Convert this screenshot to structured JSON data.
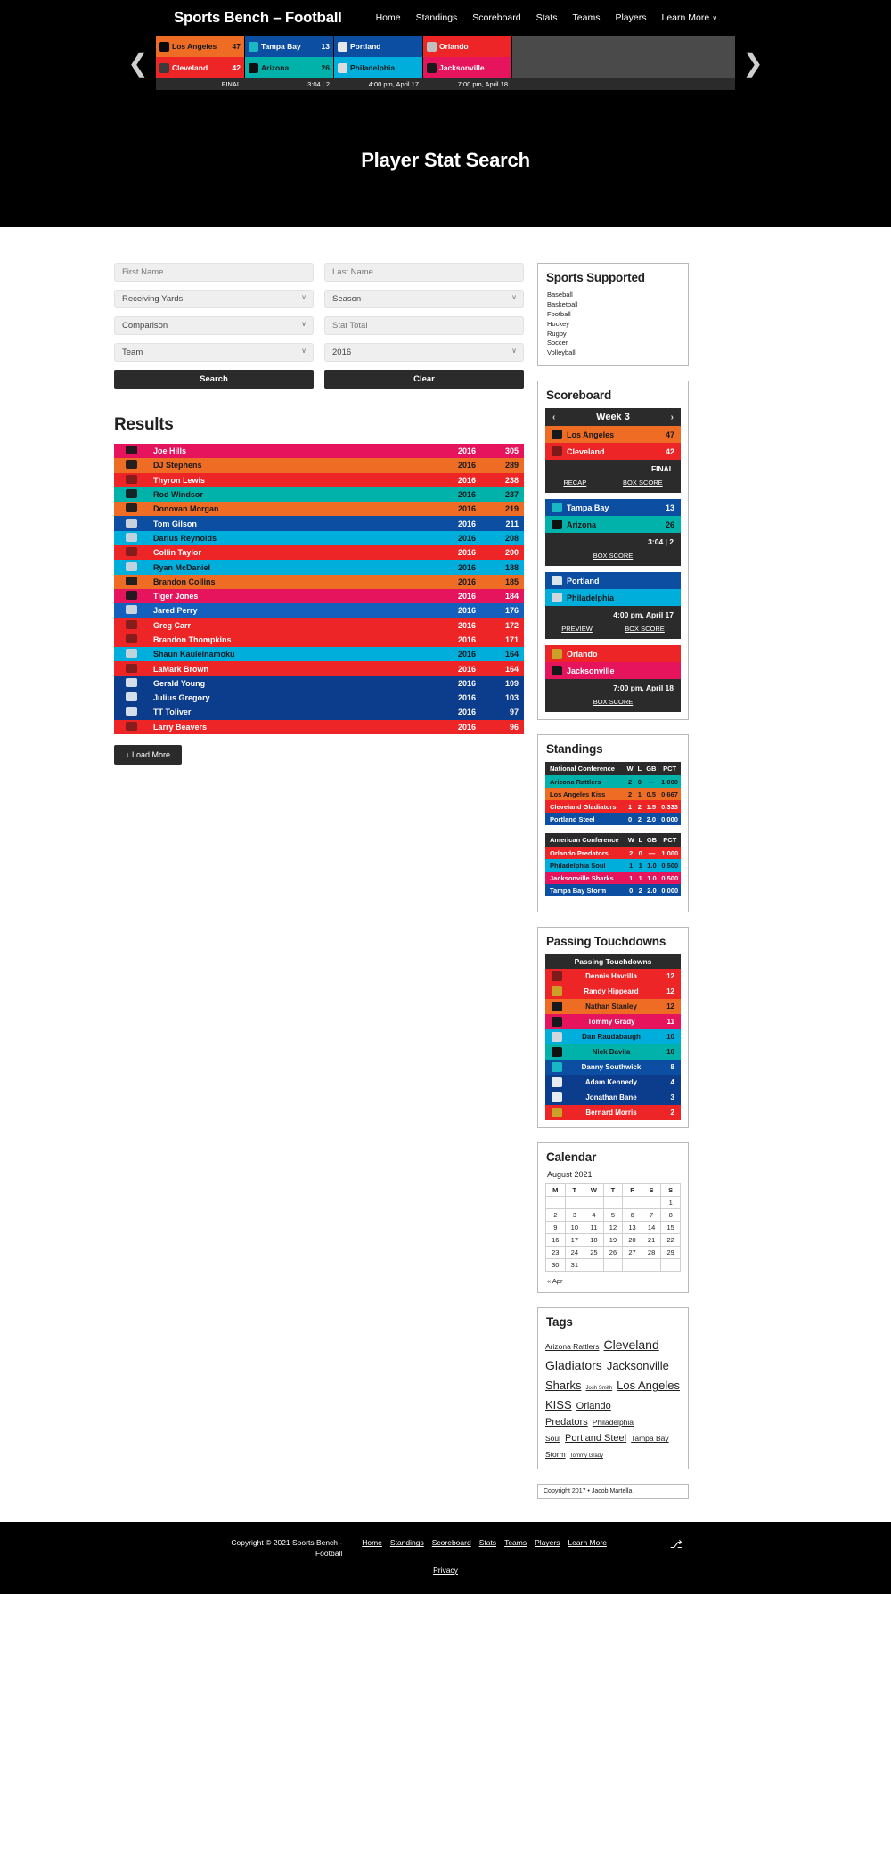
{
  "header": {
    "site_title": "Sports Bench – Football",
    "nav": [
      {
        "label": "Home"
      },
      {
        "label": "Standings"
      },
      {
        "label": "Scoreboard"
      },
      {
        "label": "Stats"
      },
      {
        "label": "Teams"
      },
      {
        "label": "Players"
      },
      {
        "label": "Learn More",
        "caret": "∨"
      }
    ],
    "prev_arrow": "❮",
    "next_arrow": "❯"
  },
  "strip_games": [
    {
      "away": {
        "name": "Los Angeles",
        "score": "47",
        "color": "#ef6c25",
        "logo": "#0a0a0a"
      },
      "home": {
        "name": "Cleveland",
        "score": "42",
        "color": "#ee2527",
        "logo": "#3b3b3b"
      },
      "status": "FINAL"
    },
    {
      "away": {
        "name": "Tampa Bay",
        "score": "13",
        "color": "#0b4ea2",
        "logo": "#19b7c4"
      },
      "home": {
        "name": "Arizona",
        "score": "26",
        "color": "#00b2a9",
        "logo": "#101010"
      },
      "status": "3:04 | 2"
    },
    {
      "away": {
        "name": "Portland",
        "score": "",
        "color": "#0b4ea2",
        "logo": "#e8e8e8"
      },
      "home": {
        "name": "Philadelphia",
        "score": "",
        "color": "#00aedb",
        "logo": "#dddddd"
      },
      "status": "4:00 pm, April 17"
    },
    {
      "away": {
        "name": "Orlando",
        "score": "",
        "color": "#ee2527",
        "logo": "#bfbfbf"
      },
      "home": {
        "name": "Jacksonville",
        "score": "",
        "color": "#e5145c",
        "logo": "#1a1a1a"
      },
      "status": "7:00 pm, April 18"
    }
  ],
  "hero": {
    "title": "Player Stat Search"
  },
  "search_form": {
    "first_name_placeholder": "First Name",
    "last_name_placeholder": "Last Name",
    "stat_selected": "Receiving Yards",
    "season_selected": "Season",
    "comparison_selected": "Comparison",
    "stat_total_placeholder": "Stat Total",
    "team_selected": "Team",
    "year_selected": "2016",
    "search_label": "Search",
    "clear_label": "Clear"
  },
  "results": {
    "heading": "Results",
    "load_more_label": "↓ Load More",
    "rows": [
      {
        "name": "Joe Hills",
        "year": "2016",
        "value": "305",
        "bg": "#e5145c",
        "fg": "#ffffff",
        "logo": "#16191c"
      },
      {
        "name": "DJ Stephens",
        "year": "2016",
        "value": "289",
        "bg": "#ef6c25",
        "fg": "#16191c",
        "logo": "#16191c"
      },
      {
        "name": "Thyron Lewis",
        "year": "2016",
        "value": "238",
        "bg": "#ee2527",
        "fg": "#ffffff",
        "logo": "#7d1b1b"
      },
      {
        "name": "Rod Windsor",
        "year": "2016",
        "value": "237",
        "bg": "#00b2a9",
        "fg": "#16191c",
        "logo": "#16191c"
      },
      {
        "name": "Donovan Morgan",
        "year": "2016",
        "value": "219",
        "bg": "#ef6c25",
        "fg": "#16191c",
        "logo": "#16191c"
      },
      {
        "name": "Tom Gilson",
        "year": "2016",
        "value": "211",
        "bg": "#0b4ea2",
        "fg": "#ffffff",
        "logo": "#d8dde2"
      },
      {
        "name": "Darius Reynolds",
        "year": "2016",
        "value": "208",
        "bg": "#00aedb",
        "fg": "#16191c",
        "logo": "#cfd6dc"
      },
      {
        "name": "Collin Taylor",
        "year": "2016",
        "value": "200",
        "bg": "#ee2527",
        "fg": "#ffffff",
        "logo": "#7d1b1b"
      },
      {
        "name": "Ryan McDaniel",
        "year": "2016",
        "value": "188",
        "bg": "#00aedb",
        "fg": "#16191c",
        "logo": "#cfd6dc"
      },
      {
        "name": "Brandon Collins",
        "year": "2016",
        "value": "185",
        "bg": "#ef6c25",
        "fg": "#16191c",
        "logo": "#16191c"
      },
      {
        "name": "Tiger Jones",
        "year": "2016",
        "value": "184",
        "bg": "#e5145c",
        "fg": "#ffffff",
        "logo": "#16191c"
      },
      {
        "name": "Jared Perry",
        "year": "2016",
        "value": "176",
        "bg": "#1560bd",
        "fg": "#ffffff",
        "logo": "#d8dde2"
      },
      {
        "name": "Greg Carr",
        "year": "2016",
        "value": "172",
        "bg": "#ee2527",
        "fg": "#ffffff",
        "logo": "#7d1b1b"
      },
      {
        "name": "Brandon Thompkins",
        "year": "2016",
        "value": "171",
        "bg": "#ee2527",
        "fg": "#ffffff",
        "logo": "#7d1b1b"
      },
      {
        "name": "Shaun Kauleinamoku",
        "year": "2016",
        "value": "164",
        "bg": "#00aedb",
        "fg": "#16191c",
        "logo": "#cfd6dc"
      },
      {
        "name": "LaMark Brown",
        "year": "2016",
        "value": "164",
        "bg": "#ee2527",
        "fg": "#ffffff",
        "logo": "#7d1b1b"
      },
      {
        "name": "Gerald Young",
        "year": "2016",
        "value": "109",
        "bg": "#0c3c8c",
        "fg": "#ffffff",
        "logo": "#e6ecf2"
      },
      {
        "name": "Julius Gregory",
        "year": "2016",
        "value": "103",
        "bg": "#0c3c8c",
        "fg": "#ffffff",
        "logo": "#e6ecf2"
      },
      {
        "name": "TT Toliver",
        "year": "2016",
        "value": "97",
        "bg": "#0c3c8c",
        "fg": "#ffffff",
        "logo": "#e6ecf2"
      },
      {
        "name": "Larry Beavers",
        "year": "2016",
        "value": "96",
        "bg": "#ee2527",
        "fg": "#ffffff",
        "logo": "#7d1b1b"
      }
    ]
  },
  "sidebar": {
    "sports_supported": {
      "title": "Sports Supported",
      "items": [
        "Baseball",
        "Basketball",
        "Football",
        "Hockey",
        "Rugby",
        "Soccer",
        "Volleyball"
      ]
    },
    "scoreboard": {
      "title": "Scoreboard",
      "week_label": "Week 3",
      "prev": "‹",
      "next": "›",
      "games": [
        {
          "away": {
            "name": "Los Angeles",
            "score": "47",
            "color": "#ef6c25",
            "fg": "#16191c",
            "logo": "#16191c"
          },
          "home": {
            "name": "Cleveland",
            "score": "42",
            "color": "#ee2527",
            "fg": "#ffffff",
            "logo": "#7d1b1b"
          },
          "status": "FINAL",
          "links": [
            "RECAP",
            "BOX SCORE"
          ]
        },
        {
          "away": {
            "name": "Tampa Bay",
            "score": "13",
            "color": "#0b4ea2",
            "fg": "#ffffff",
            "logo": "#19b7c4"
          },
          "home": {
            "name": "Arizona",
            "score": "26",
            "color": "#00b2a9",
            "fg": "#16191c",
            "logo": "#101010"
          },
          "status": "3:04 | 2",
          "links": [
            "BOX SCORE"
          ]
        },
        {
          "away": {
            "name": "Portland",
            "score": "",
            "color": "#0b4ea2",
            "fg": "#ffffff",
            "logo": "#dbe3ea"
          },
          "home": {
            "name": "Philadelphia",
            "score": "",
            "color": "#00aedb",
            "fg": "#16191c",
            "logo": "#cfd6dc"
          },
          "status": "4:00 pm, April 17",
          "links": [
            "PREVIEW",
            "BOX SCORE"
          ]
        },
        {
          "away": {
            "name": "Orlando",
            "score": "",
            "color": "#ee2527",
            "fg": "#ffffff",
            "logo": "#c9a227"
          },
          "home": {
            "name": "Jacksonville",
            "score": "",
            "color": "#e5145c",
            "fg": "#ffffff",
            "logo": "#16191c"
          },
          "status": "7:00 pm, April 18",
          "links": [
            "BOX SCORE"
          ]
        }
      ]
    },
    "standings": {
      "title": "Standings",
      "columns": [
        "W",
        "L",
        "GB",
        "PCT"
      ],
      "conferences": [
        {
          "name": "National Conference",
          "teams": [
            {
              "team": "Arizona Rattlers",
              "w": "2",
              "l": "0",
              "gb": "—",
              "pct": "1.000",
              "bg": "#00b2a9",
              "fg": "#16191c"
            },
            {
              "team": "Los Angeles Kiss",
              "w": "2",
              "l": "1",
              "gb": "0.5",
              "pct": "0.667",
              "bg": "#ef6c25",
              "fg": "#16191c"
            },
            {
              "team": "Cleveland Gladiators",
              "w": "1",
              "l": "2",
              "gb": "1.5",
              "pct": "0.333",
              "bg": "#ee2527",
              "fg": "#ffffff"
            },
            {
              "team": "Portland Steel",
              "w": "0",
              "l": "2",
              "gb": "2.0",
              "pct": "0.000",
              "bg": "#0b4ea2",
              "fg": "#ffffff"
            }
          ]
        },
        {
          "name": "American Conference",
          "teams": [
            {
              "team": "Orlando Predators",
              "w": "2",
              "l": "0",
              "gb": "—",
              "pct": "1.000",
              "bg": "#ee2527",
              "fg": "#ffffff"
            },
            {
              "team": "Philadelphia Soul",
              "w": "1",
              "l": "1",
              "gb": "1.0",
              "pct": "0.500",
              "bg": "#00aedb",
              "fg": "#16191c"
            },
            {
              "team": "Jacksonville Sharks",
              "w": "1",
              "l": "1",
              "gb": "1.0",
              "pct": "0.500",
              "bg": "#e5145c",
              "fg": "#ffffff"
            },
            {
              "team": "Tampa Bay Storm",
              "w": "0",
              "l": "2",
              "gb": "2.0",
              "pct": "0.000",
              "bg": "#0b4ea2",
              "fg": "#ffffff"
            }
          ]
        }
      ]
    },
    "passing_touchdowns": {
      "title": "Passing Touchdowns",
      "table_header": "Passing Touchdowns",
      "rows": [
        {
          "name": "Dennis Havrilla",
          "value": "12",
          "bg": "#ee2527",
          "fg": "#ffffff",
          "logo": "#7d1b1b"
        },
        {
          "name": "Randy Hippeard",
          "value": "12",
          "bg": "#ee2527",
          "fg": "#ffffff",
          "logo": "#c9a227"
        },
        {
          "name": "Nathan Stanley",
          "value": "12",
          "bg": "#ef6c25",
          "fg": "#16191c",
          "logo": "#16191c"
        },
        {
          "name": "Tommy Grady",
          "value": "11",
          "bg": "#e5145c",
          "fg": "#ffffff",
          "logo": "#16191c"
        },
        {
          "name": "Dan Raudabaugh",
          "value": "10",
          "bg": "#00aedb",
          "fg": "#16191c",
          "logo": "#cfd6dc"
        },
        {
          "name": "Nick Davila",
          "value": "10",
          "bg": "#00b2a9",
          "fg": "#16191c",
          "logo": "#101010"
        },
        {
          "name": "Danny Southwick",
          "value": "8",
          "bg": "#0b4ea2",
          "fg": "#ffffff",
          "logo": "#19b7c4"
        },
        {
          "name": "Adam Kennedy",
          "value": "4",
          "bg": "#0c3c8c",
          "fg": "#ffffff",
          "logo": "#e6ecf2"
        },
        {
          "name": "Jonathan Bane",
          "value": "3",
          "bg": "#0c3c8c",
          "fg": "#ffffff",
          "logo": "#e6ecf2"
        },
        {
          "name": "Bernard Morris",
          "value": "2",
          "bg": "#ee2527",
          "fg": "#ffffff",
          "logo": "#c9a227"
        }
      ]
    },
    "calendar": {
      "title": "Calendar",
      "month": "August 2021",
      "day_headers": [
        "M",
        "T",
        "W",
        "T",
        "F",
        "S",
        "S"
      ],
      "weeks": [
        [
          "",
          "",
          "",
          "",
          "",
          "",
          "1"
        ],
        [
          "2",
          "3",
          "4",
          "5",
          "6",
          "7",
          "8"
        ],
        [
          "9",
          "10",
          "11",
          "12",
          "13",
          "14",
          "15"
        ],
        [
          "16",
          "17",
          "18",
          "19",
          "20",
          "21",
          "22"
        ],
        [
          "23",
          "24",
          "25",
          "26",
          "27",
          "28",
          "29"
        ],
        [
          "30",
          "31",
          "",
          "",
          "",
          "",
          ""
        ]
      ],
      "prev_link": "« Apr"
    },
    "tags": {
      "title": "Tags",
      "items": [
        {
          "label": "Arizona Rattlers",
          "size": "t-sm"
        },
        {
          "label": "Cleveland Gladiators",
          "size": "t-xl"
        },
        {
          "label": "Jacksonville Sharks",
          "size": "t-lg"
        },
        {
          "label": "Josh Smith",
          "size": "t-xs"
        },
        {
          "label": "Los Angeles KISS",
          "size": "t-lg"
        },
        {
          "label": "Orlando Predators",
          "size": "t-md"
        },
        {
          "label": "Philadelphia Soul",
          "size": "t-sm"
        },
        {
          "label": "Portland Steel",
          "size": "t-md"
        },
        {
          "label": "Tampa Bay Storm",
          "size": "t-sm"
        },
        {
          "label": "Tommy Grady",
          "size": "t-xs"
        }
      ]
    },
    "copyright_box": "Copyright 2017 • Jacob Martella"
  },
  "footer": {
    "copyright": "Copyright © 2021 Sports Bench - Football",
    "nav": [
      "Home",
      "Standings",
      "Scoreboard",
      "Stats",
      "Teams",
      "Players",
      "Learn More"
    ],
    "rss_icon": "⎇",
    "privacy": "Privacy"
  }
}
